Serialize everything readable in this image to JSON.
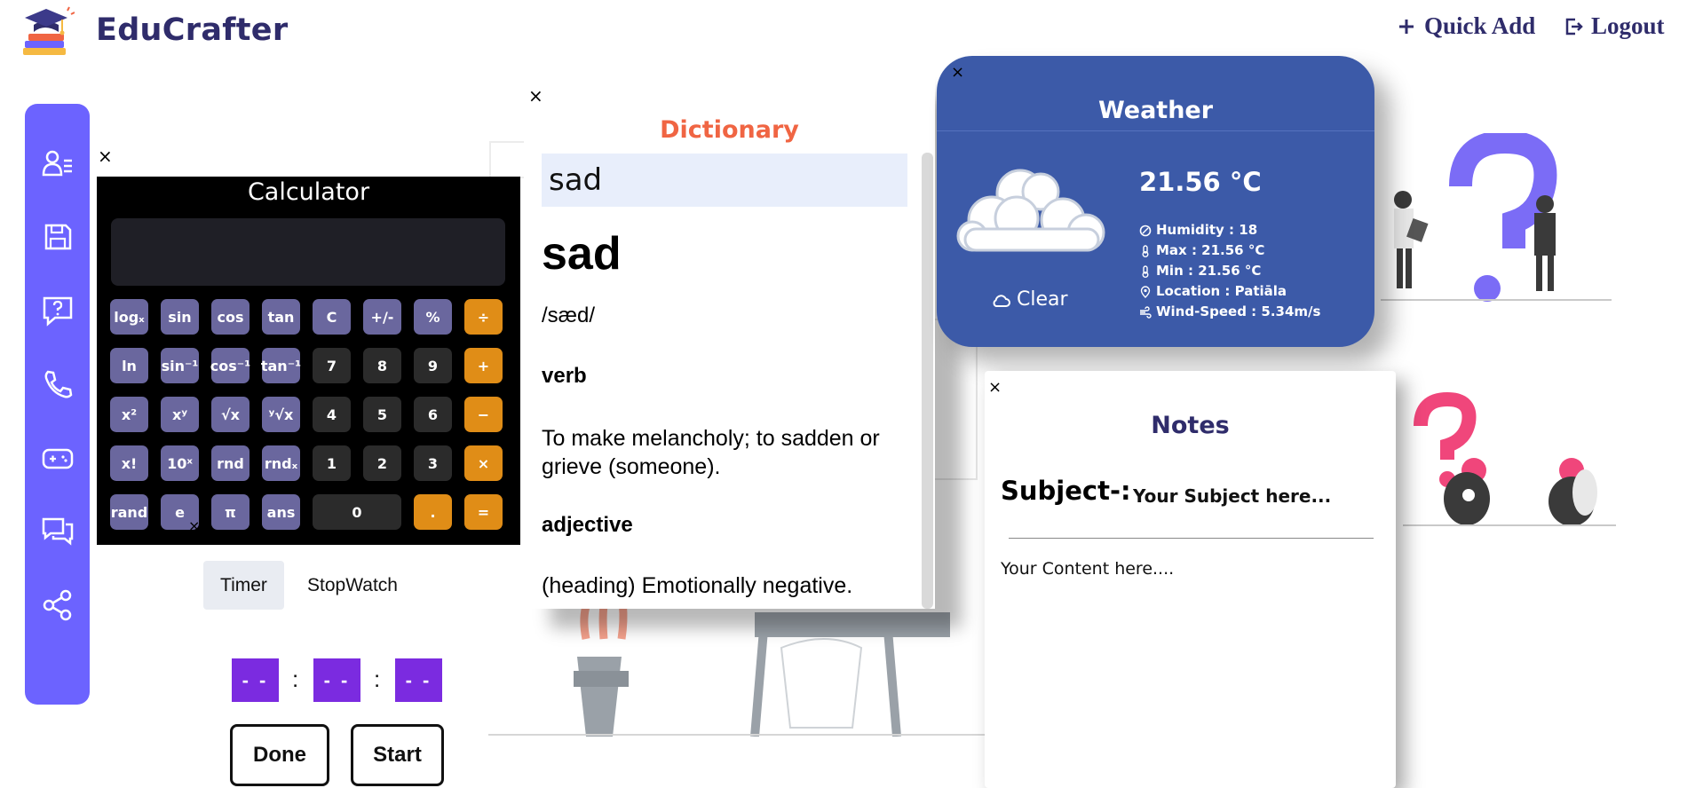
{
  "header": {
    "brand": "EduCrafter",
    "quick_add_label": "Quick Add",
    "logout_label": "Logout"
  },
  "sidebar": {
    "items": [
      {
        "icon": "profile-list-icon"
      },
      {
        "icon": "save-icon"
      },
      {
        "icon": "question-icon"
      },
      {
        "icon": "phone-icon"
      },
      {
        "icon": "gamepad-icon"
      },
      {
        "icon": "chat-icon"
      },
      {
        "icon": "share-icon"
      }
    ]
  },
  "close_glyph": "×",
  "calculator": {
    "title": "Calculator",
    "display": "",
    "keys": {
      "logx": "logₓ",
      "sin": "sin",
      "cos": "cos",
      "tan": "tan",
      "clear": "C",
      "sign": "+/-",
      "percent": "%",
      "divide": "÷",
      "ln": "ln",
      "asin": "sin⁻¹",
      "acos": "cos⁻¹",
      "atan": "tan⁻¹",
      "seven": "7",
      "eight": "8",
      "nine": "9",
      "plus": "+",
      "square": "x²",
      "pow": "xʸ",
      "sqrt": "√x",
      "yroot": "ʸ√x",
      "four": "4",
      "five": "5",
      "six": "6",
      "minus": "−",
      "fact": "x!",
      "tenpow": "10ˣ",
      "rnd": "rnd",
      "rndx": "rndₓ",
      "one": "1",
      "two": "2",
      "three": "3",
      "multiply": "×",
      "rand": "rand",
      "e": "e",
      "pi": "π",
      "ans": "ans",
      "zero": "0",
      "dot": ".",
      "equals": "="
    }
  },
  "timer": {
    "tab_timer": "Timer",
    "tab_stopwatch": "StopWatch",
    "hours": "- -",
    "minutes": "- -",
    "seconds": "- -",
    "colon": ":",
    "done_label": "Done",
    "start_label": "Start"
  },
  "dictionary": {
    "title": "Dictionary",
    "query": "sad",
    "word": "sad",
    "phonetic": "/sæd/",
    "pos1": "verb",
    "def1": "To make melancholy; to sadden or grieve (someone).",
    "pos2": "adjective",
    "def2": "(heading) Emotionally negative."
  },
  "weather": {
    "title": "Weather",
    "temperature": "21.56 °C",
    "condition": "Clear",
    "humidity": "Humidity : 18",
    "max": "Max : 21.56 °C",
    "min": "Min : 21.56 °C",
    "location": "Location : Patiāla",
    "wind": "Wind-Speed : 5.34m/s"
  },
  "notes": {
    "title": "Notes",
    "subject_label": "Subject-:",
    "subject_placeholder": "Your Subject here...",
    "content_placeholder": "Your Content here...."
  },
  "colors": {
    "brand": "#2f2c6b",
    "sidebar": "#6c63ff",
    "accent_orange": "#e08d17",
    "weather_bg": "#3c5aa8",
    "dict_title": "#f06543",
    "timer_box": "#7b2be0"
  }
}
